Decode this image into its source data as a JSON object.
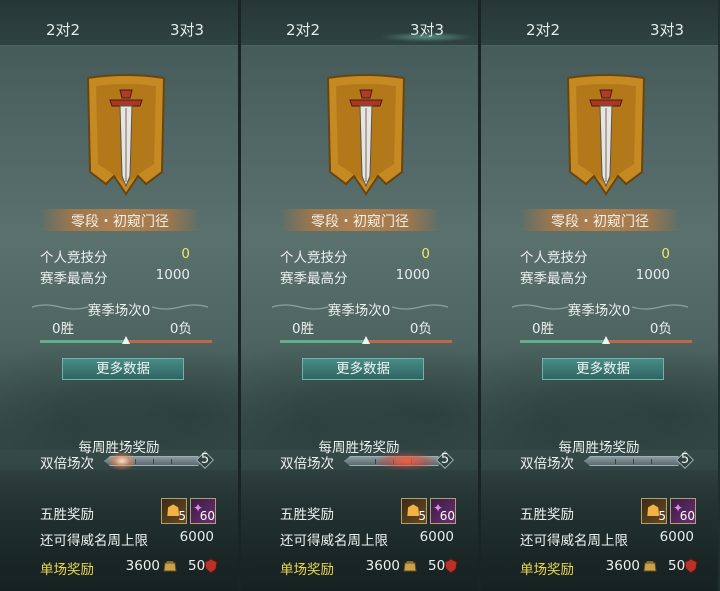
{
  "panels": [
    {
      "tabs": {
        "left": "2对2",
        "right": "3对3",
        "active": "none"
      },
      "rank_title": "零段・初窥门径",
      "stats": [
        {
          "label": "个人竞技分",
          "value": "0",
          "highlight": true
        },
        {
          "label": "赛季最高分",
          "value": "1000",
          "highlight": false
        }
      ],
      "season": {
        "title": "赛季场次0",
        "wins": "0胜",
        "losses": "0负",
        "balance": 0.5
      },
      "more_button": "更多数据",
      "weekly": {
        "title": "每周胜场奖励",
        "double_label": "双倍场次",
        "double_count": "5",
        "glow": "small"
      },
      "five_win": {
        "label": "五胜奖励",
        "items": [
          {
            "icon": "gold-rune-icon",
            "count": "5"
          },
          {
            "icon": "purple-rune-icon",
            "count": "60"
          }
        ]
      },
      "cap": {
        "label": "还可得威名周上限",
        "value": "6000"
      },
      "single": {
        "label": "单场奖励",
        "value1": "3600",
        "icon1": "coin-pouch-icon",
        "value2": "50",
        "icon2": "red-shield-icon"
      }
    },
    {
      "tabs": {
        "left": "2对2",
        "right": "3对3",
        "active": "right"
      },
      "rank_title": "零段・初窥门径",
      "stats": [
        {
          "label": "个人竞技分",
          "value": "0",
          "highlight": true
        },
        {
          "label": "赛季最高分",
          "value": "1000",
          "highlight": false
        }
      ],
      "season": {
        "title": "赛季场次0",
        "wins": "0胜",
        "losses": "0负",
        "balance": 0.5
      },
      "more_button": "更多数据",
      "weekly": {
        "title": "每周胜场奖励",
        "double_label": "双倍场次",
        "double_count": "5",
        "glow": "large"
      },
      "five_win": {
        "label": "五胜奖励",
        "items": [
          {
            "icon": "gold-rune-icon",
            "count": "5"
          },
          {
            "icon": "purple-rune-icon",
            "count": "60"
          }
        ]
      },
      "cap": {
        "label": "还可得威名周上限",
        "value": "6000"
      },
      "single": {
        "label": "单场奖励",
        "value1": "3600",
        "icon1": "coin-pouch-icon",
        "value2": "50",
        "icon2": "red-shield-icon"
      }
    },
    {
      "tabs": {
        "left": "2对2",
        "right": "3对3",
        "active": "none"
      },
      "rank_title": "零段・初窥门径",
      "stats": [
        {
          "label": "个人竞技分",
          "value": "0",
          "highlight": true
        },
        {
          "label": "赛季最高分",
          "value": "1000",
          "highlight": false
        }
      ],
      "season": {
        "title": "赛季场次0",
        "wins": "0胜",
        "losses": "0负",
        "balance": 0.5
      },
      "more_button": "更多数据",
      "weekly": {
        "title": "每周胜场奖励",
        "double_label": "双倍场次",
        "double_count": "5",
        "glow": "none"
      },
      "five_win": {
        "label": "五胜奖励",
        "items": [
          {
            "icon": "gold-rune-icon",
            "count": "5"
          },
          {
            "icon": "purple-rune-icon",
            "count": "60"
          }
        ]
      },
      "cap": {
        "label": "还可得威名周上限",
        "value": "6000"
      },
      "single": {
        "label": "单场奖励",
        "value1": "3600",
        "icon1": "coin-pouch-icon",
        "value2": "50",
        "icon2": "red-shield-icon"
      }
    }
  ],
  "colors": {
    "highlight": "#f0e66a",
    "single_label": "#e9d94a",
    "win": "#5fb08a",
    "loss": "#b86a48",
    "button": "#3d7a76"
  }
}
